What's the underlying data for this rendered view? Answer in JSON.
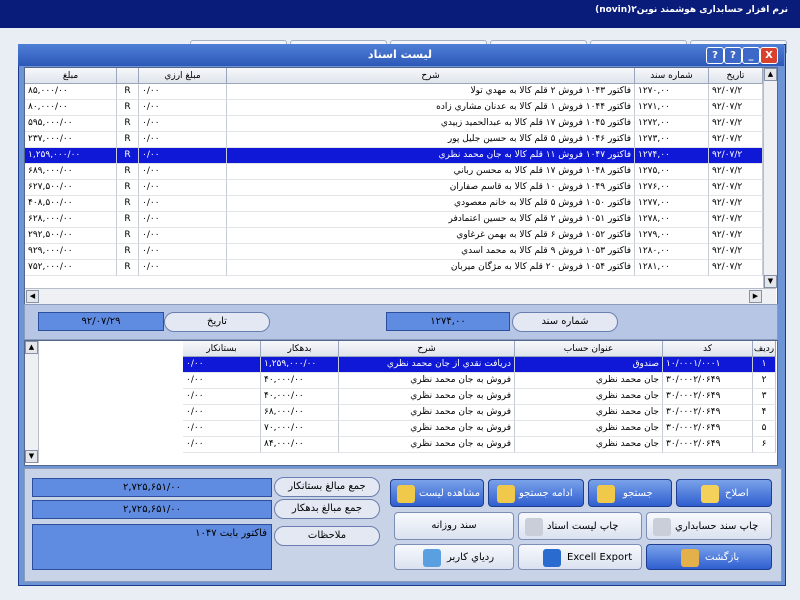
{
  "app": {
    "title": "نرم افزار حسابداری هوشمند نوین۲(novin)"
  },
  "dialog": {
    "title": "لیست اسناد",
    "close": "X",
    "minimize": "_",
    "help": "?",
    "help2": "?"
  },
  "doc_table": {
    "headers": {
      "date": "تاریخ",
      "doc_no": "شماره سند",
      "desc": "شرح",
      "fx_amount": "مبلغ ارزي",
      "fx_flag": "",
      "amount": "مبلغ"
    },
    "rows": [
      {
        "date": "۹۲/۰۷/۲",
        "doc_no": "۱۲۷۰,۰۰",
        "desc": "فاکتور ۱۰۴۳ فروش ۲ قلم کالا به مهدي تولا",
        "fx_amount": "۰/۰۰",
        "fx_flag": "R",
        "amount": "۸۵,۰۰۰/۰۰"
      },
      {
        "date": "۹۲/۰۷/۲",
        "doc_no": "۱۲۷۱,۰۰",
        "desc": "فاکتور ۱۰۴۴ فروش ۱ قلم کالا به عدنان مشاري زاده",
        "fx_amount": "۰/۰۰",
        "fx_flag": "R",
        "amount": "۸۰,۰۰۰/۰۰"
      },
      {
        "date": "۹۲/۰۷/۲",
        "doc_no": "۱۲۷۲,۰۰",
        "desc": "فاکتور ۱۰۴۵ فروش ۱۷ قلم کالا به عبدالحميد زبيدي",
        "fx_amount": "۰/۰۰",
        "fx_flag": "R",
        "amount": "۵۹۵,۰۰۰/۰۰"
      },
      {
        "date": "۹۲/۰۷/۲",
        "doc_no": "۱۲۷۳,۰۰",
        "desc": "فاکتور ۱۰۴۶ فروش ۵ قلم کالا به حسين جليل پور",
        "fx_amount": "۰/۰۰",
        "fx_flag": "R",
        "amount": "۲۳۷,۰۰۰/۰۰"
      },
      {
        "date": "۹۲/۰۷/۲",
        "doc_no": "۱۲۷۴,۰۰",
        "desc": "فاکتور ۱۰۴۷ فروش ۱۱ قلم کالا به جان محمد نظري",
        "fx_amount": "۰/۰۰",
        "fx_flag": "R",
        "amount": "۱,۲۵۹,۰۰۰/۰۰"
      },
      {
        "date": "۹۲/۰۷/۲",
        "doc_no": "۱۲۷۵,۰۰",
        "desc": "فاکتور ۱۰۴۸ فروش ۱۷ قلم کالا به محسن رباني",
        "fx_amount": "۰/۰۰",
        "fx_flag": "R",
        "amount": "۶۸۹,۰۰۰/۰۰"
      },
      {
        "date": "۹۲/۰۷/۲",
        "doc_no": "۱۲۷۶,۰۰",
        "desc": "فاکتور ۱۰۴۹ فروش ۱۰ قلم کالا به قاسم صفاران",
        "fx_amount": "۰/۰۰",
        "fx_flag": "R",
        "amount": "۶۲۷,۵۰۰/۰۰"
      },
      {
        "date": "۹۲/۰۷/۲",
        "doc_no": "۱۲۷۷,۰۰",
        "desc": "فاکتور ۱۰۵۰ فروش ۵ قلم کالا به خانم معصودي",
        "fx_amount": "۰/۰۰",
        "fx_flag": "R",
        "amount": "۴۰۸,۵۰۰/۰۰"
      },
      {
        "date": "۹۲/۰۷/۲",
        "doc_no": "۱۲۷۸,۰۰",
        "desc": "فاکتور ۱۰۵۱ فروش ۲ قلم کالا به حسين اعتمادفر",
        "fx_amount": "۰/۰۰",
        "fx_flag": "R",
        "amount": "۶۲۸,۰۰۰/۰۰"
      },
      {
        "date": "۹۲/۰۷/۲",
        "doc_no": "۱۲۷۹,۰۰",
        "desc": "فاکتور ۱۰۵۲ فروش ۶ قلم کالا به بهمن غرغاوي",
        "fx_amount": "۰/۰۰",
        "fx_flag": "R",
        "amount": "۲۹۲,۵۰۰/۰۰"
      },
      {
        "date": "۹۲/۰۷/۲",
        "doc_no": "۱۲۸۰,۰۰",
        "desc": "فاکتور ۱۰۵۳ فروش ۹ قلم کالا به محمد اسدي",
        "fx_amount": "۰/۰۰",
        "fx_flag": "R",
        "amount": "۹۲۹,۰۰۰/۰۰"
      },
      {
        "date": "۹۲/۰۷/۲",
        "doc_no": "۱۲۸۱,۰۰",
        "desc": "فاکتور ۱۰۵۴ فروش ۲۰ قلم کالا به مژگان ميربان",
        "fx_amount": "۰/۰۰",
        "fx_flag": "R",
        "amount": "۷۵۲,۰۰۰/۰۰"
      }
    ],
    "selected_index": 4
  },
  "info": {
    "doc_no_label": "شماره سند",
    "doc_no_value": "۱۲۷۴,۰۰",
    "date_label": "تاریخ",
    "date_value": "۹۲/۰۷/۲۹"
  },
  "detail_table": {
    "headers": {
      "row": "رديف",
      "code": "کد",
      "account": "عنوان حساب",
      "desc": "شرح",
      "debit": "بدهکار",
      "credit": "بستانکار"
    },
    "rows": [
      {
        "row": "۱",
        "code": "۱۰/۰۰۰۱/۰۰۰۱",
        "account": "صندوق",
        "desc": "دريافت نقدي از جان محمد نظري",
        "debit": "۱,۲۵۹,۰۰۰/۰۰",
        "credit": "۰/۰۰"
      },
      {
        "row": "۲",
        "code": "۳۰/۰۰۰۲/۰۶۴۹",
        "account": "جان محمد نظري",
        "desc": "فروش به جان محمد نظري",
        "debit": "۴۰,۰۰۰/۰۰",
        "credit": "۰/۰۰"
      },
      {
        "row": "۳",
        "code": "۳۰/۰۰۰۲/۰۶۴۹",
        "account": "جان محمد نظري",
        "desc": "فروش به جان محمد نظري",
        "debit": "۴۰,۰۰۰/۰۰",
        "credit": "۰/۰۰"
      },
      {
        "row": "۴",
        "code": "۳۰/۰۰۰۲/۰۶۴۹",
        "account": "جان محمد نظري",
        "desc": "فروش به جان محمد نظري",
        "debit": "۶۸,۰۰۰/۰۰",
        "credit": "۰/۰۰"
      },
      {
        "row": "۵",
        "code": "۳۰/۰۰۰۲/۰۶۴۹",
        "account": "جان محمد نظري",
        "desc": "فروش به جان محمد نظري",
        "debit": "۷۰,۰۰۰/۰۰",
        "credit": "۰/۰۰"
      },
      {
        "row": "۶",
        "code": "۳۰/۰۰۰۲/۰۶۴۹",
        "account": "جان محمد نظري",
        "desc": "فروش به جان محمد نظري",
        "debit": "۸۴,۰۰۰/۰۰",
        "credit": "۰/۰۰"
      }
    ],
    "selected_index": 0
  },
  "totals": {
    "credit_label": "جمع مبالغ بستانکار",
    "credit_value": "۲,۷۲۵,۶۵۱/۰۰",
    "debit_label": "جمع مبالغ بدهکار",
    "debit_value": "۲,۷۲۵,۶۵۱/۰۰",
    "notes_label": "ملاحظات",
    "notes_value": "فاکتور بابت ۱۰۴۷"
  },
  "buttons": {
    "edit": "اصلاح",
    "search": "جستجو",
    "continue_search": "ادامه جستجو",
    "view_list": "مشاهده ليست",
    "print_doc": "چاپ سند حسابداري",
    "print_list": "چاپ ليست اسناد",
    "daily_doc": "سند روزانه",
    "back": "بازگشت",
    "excel": "Excell Export",
    "user_trace": "ردياي کاربر"
  }
}
